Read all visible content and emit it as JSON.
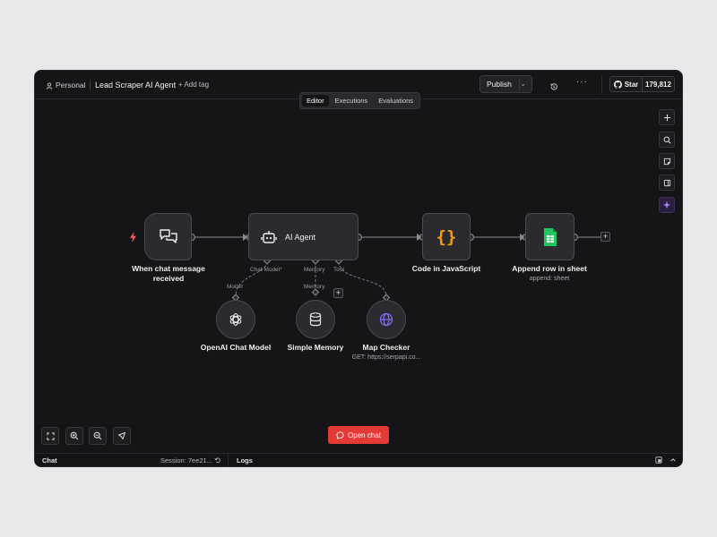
{
  "header": {
    "project": "Personal",
    "workflow_name": "Lead Scraper AI Agent",
    "add_tag": "+ Add tag",
    "publish_label": "Publish",
    "github_star_label": "Star",
    "github_star_count": "179,812"
  },
  "tabs": [
    {
      "label": "Editor",
      "active": true
    },
    {
      "label": "Executions",
      "active": false
    },
    {
      "label": "Evaluations",
      "active": false
    }
  ],
  "nodes": {
    "trigger": {
      "label": "When chat message received",
      "icon": "chat-icon"
    },
    "agent": {
      "label": "AI Agent",
      "icon": "robot-icon"
    },
    "code": {
      "label": "Code in JavaScript",
      "icon": "braces-icon",
      "color": "#f59e0b"
    },
    "sheet": {
      "label": "Append row in sheet",
      "sub": "append: sheet",
      "icon": "google-sheets-icon",
      "color": "#22c55e"
    },
    "openai": {
      "label": "OpenAI Chat Model",
      "icon": "openai-icon"
    },
    "memory": {
      "label": "Simple Memory",
      "icon": "database-icon"
    },
    "map": {
      "label": "Map Checker",
      "sub": "GET: https://serpapi.co...",
      "icon": "globe-icon",
      "color": "#7c6cf0"
    }
  },
  "ports": {
    "chat_model": "Chat Model",
    "required_marker": "*",
    "memory": "Memory",
    "tool": "Tool",
    "model": "Model",
    "memory_sub": "Memory"
  },
  "canvas_controls": {
    "open_chat": "Open chat"
  },
  "bottom_bar": {
    "chat": "Chat",
    "session": "Session: 7ee21...",
    "logs": "Logs"
  },
  "colors": {
    "accent_red": "#e53935",
    "trigger_bolt": "#ff5a5f",
    "ai_assistant": "#a78bfa"
  }
}
